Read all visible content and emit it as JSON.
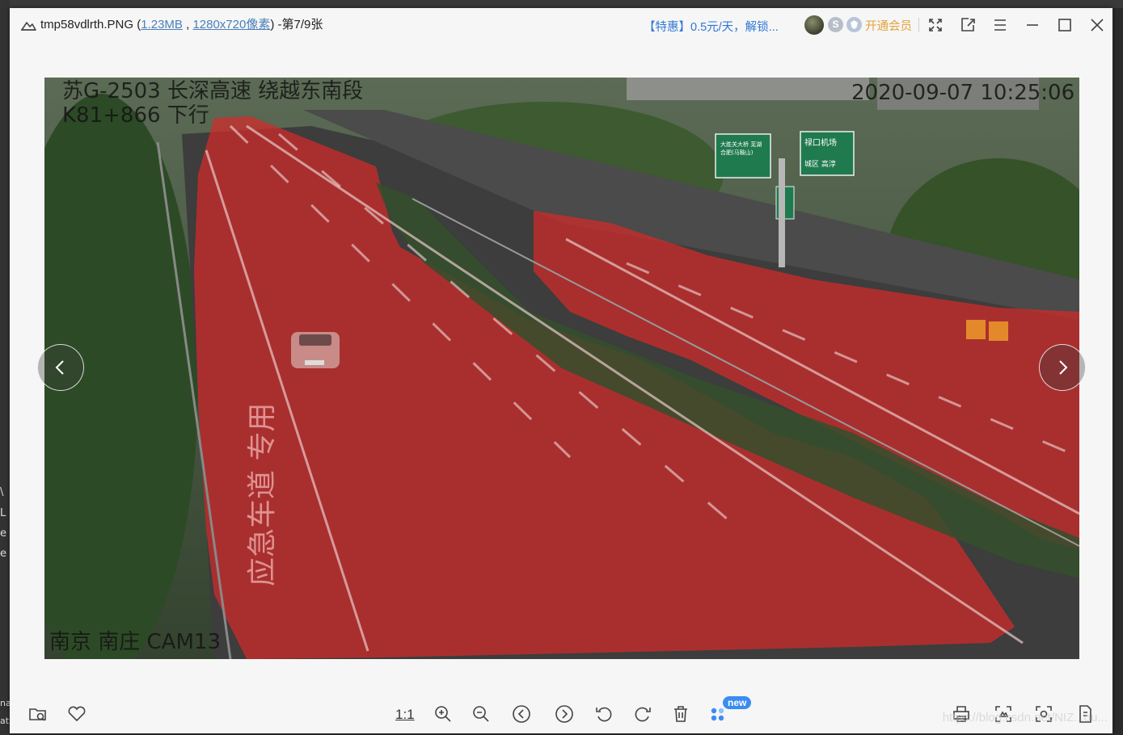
{
  "window": {
    "filename": "tmp58vdlrth.PNG",
    "file_size": "1.23MB",
    "dimensions": "1280x720像素",
    "counter": "-第7/9张",
    "promo": "【特惠】0.5元/天，解锁...",
    "vip_label": "开通会员",
    "svip_letter": "S"
  },
  "photo": {
    "overlay_top_left_line1": "苏G-2503 长深高速 绕越东南段",
    "overlay_top_left_line2": "K81+866 下行",
    "overlay_timestamp": "2020-09-07 10:25:06",
    "overlay_bottom_left": "南京 南庄 CAM13",
    "sign_left_text": "大胜关大桥 芜湖 合肥(马鞍山)",
    "sign_right_line1": "禄口机场",
    "sign_right_line2": "城区 高淳",
    "road_mark_text": "应急车道 专用",
    "mask_color": "#d42a2a"
  },
  "bottom_toolbar": {
    "actual_size_label": "1:1",
    "new_badge": "new"
  },
  "watermark": "https://blog.csdn.net/NIZ...ou...",
  "background_app": {
    "fragments": [
      "\\",
      "L",
      "e",
      "e",
      "na",
      "at"
    ]
  }
}
